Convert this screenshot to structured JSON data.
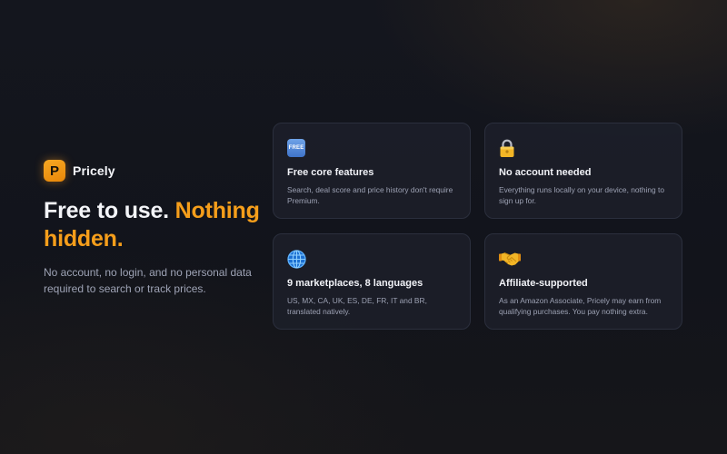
{
  "brand": {
    "logo_letter": "P",
    "name": "Pricely",
    "accent_color": "#f59e1b"
  },
  "hero": {
    "headline_plain": "Free to use.",
    "headline_accent": "Nothing hidden.",
    "subtext": "No account, no login, and no personal data required to search or track prices."
  },
  "features": [
    {
      "icon": "free-button-icon",
      "icon_text": "FREE",
      "title": "Free core features",
      "description": "Search, deal score and price history don't require Premium."
    },
    {
      "icon": "lock-icon",
      "title": "No account needed",
      "description": "Everything runs locally on your device, nothing to sign up for."
    },
    {
      "icon": "globe-icon",
      "title": "9 marketplaces, 8 languages",
      "description": "US, MX, CA, UK, ES, DE, FR, IT and BR, translated natively."
    },
    {
      "icon": "handshake-icon",
      "title": "Affiliate-supported",
      "description": "As an Amazon Associate, Pricely may earn from qualifying purchases. You pay nothing extra."
    }
  ]
}
